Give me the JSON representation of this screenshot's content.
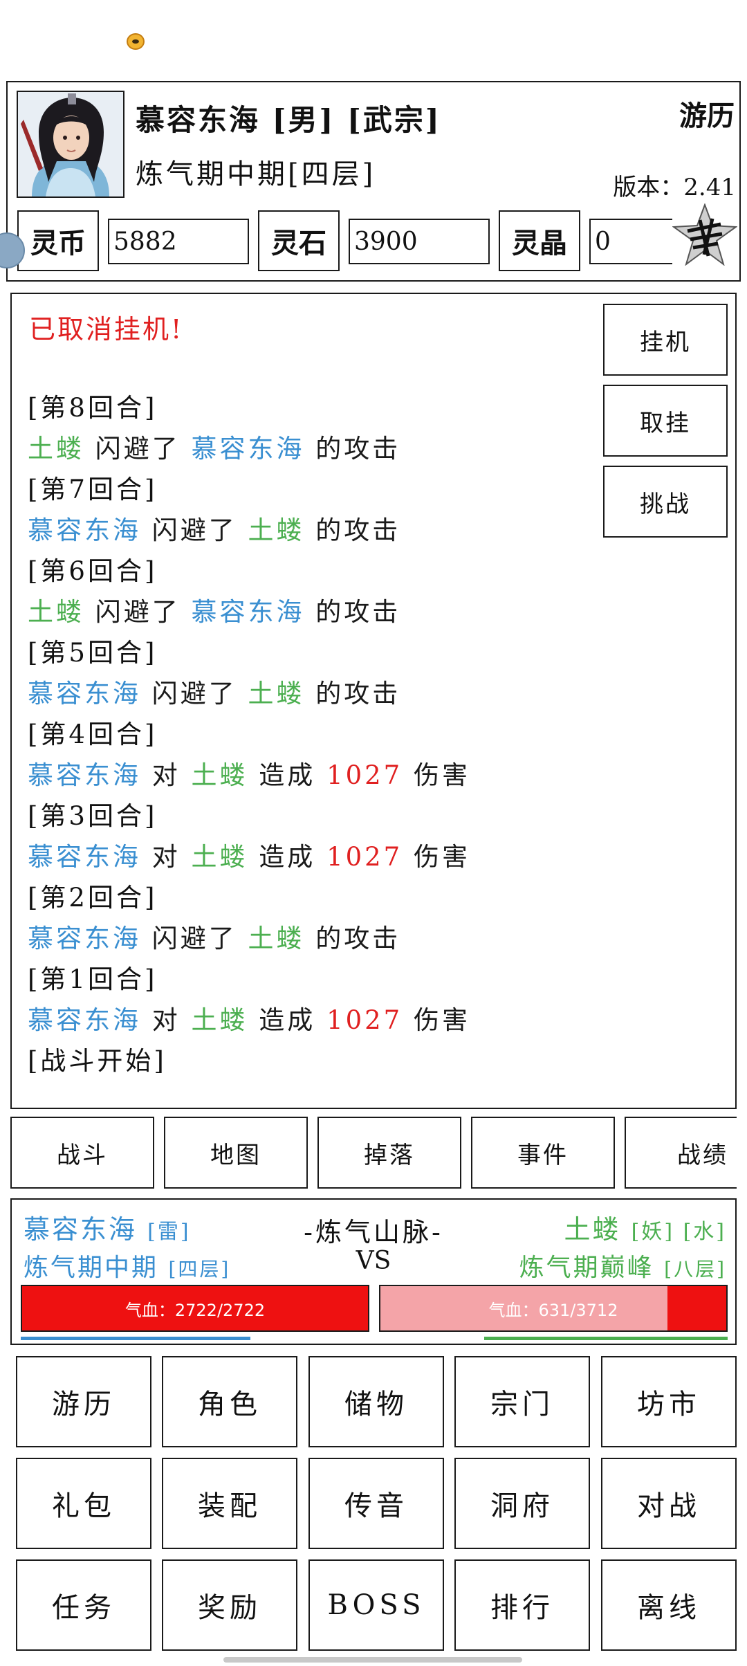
{
  "header": {
    "player_name": "慕容东海 [男] [武宗]",
    "player_realm": "炼气期中期[四层]",
    "location_title": "游历",
    "version_label": "版本：",
    "version_value": "2.41"
  },
  "currencies": [
    {
      "label": "灵币",
      "value": "5882"
    },
    {
      "label": "灵石",
      "value": "3900"
    },
    {
      "label": "灵晶",
      "value": "0"
    }
  ],
  "log": {
    "status_message": "已取消挂机!",
    "lines": [
      {
        "type": "round",
        "text": "[第8回合]"
      },
      {
        "type": "event",
        "parts": [
          {
            "t": "土蝼",
            "c": "green"
          },
          {
            "t": " 闪避了 ",
            "c": "black"
          },
          {
            "t": "慕容东海",
            "c": "blue"
          },
          {
            "t": " 的攻击",
            "c": "black"
          }
        ]
      },
      {
        "type": "round",
        "text": "[第7回合]"
      },
      {
        "type": "event",
        "parts": [
          {
            "t": "慕容东海",
            "c": "blue"
          },
          {
            "t": " 闪避了 ",
            "c": "black"
          },
          {
            "t": "土蝼",
            "c": "green"
          },
          {
            "t": " 的攻击",
            "c": "black"
          }
        ]
      },
      {
        "type": "round",
        "text": "[第6回合]"
      },
      {
        "type": "event",
        "parts": [
          {
            "t": "土蝼",
            "c": "green"
          },
          {
            "t": " 闪避了 ",
            "c": "black"
          },
          {
            "t": "慕容东海",
            "c": "blue"
          },
          {
            "t": " 的攻击",
            "c": "black"
          }
        ]
      },
      {
        "type": "round",
        "text": "[第5回合]"
      },
      {
        "type": "event",
        "parts": [
          {
            "t": "慕容东海",
            "c": "blue"
          },
          {
            "t": " 闪避了 ",
            "c": "black"
          },
          {
            "t": "土蝼",
            "c": "green"
          },
          {
            "t": " 的攻击",
            "c": "black"
          }
        ]
      },
      {
        "type": "round",
        "text": "[第4回合]"
      },
      {
        "type": "event",
        "parts": [
          {
            "t": "慕容东海",
            "c": "blue"
          },
          {
            "t": " 对 ",
            "c": "black"
          },
          {
            "t": "土蝼",
            "c": "green"
          },
          {
            "t": " 造成 ",
            "c": "black"
          },
          {
            "t": "1027",
            "c": "red"
          },
          {
            "t": " 伤害",
            "c": "black"
          }
        ]
      },
      {
        "type": "round",
        "text": "[第3回合]"
      },
      {
        "type": "event",
        "parts": [
          {
            "t": "慕容东海",
            "c": "blue"
          },
          {
            "t": " 对 ",
            "c": "black"
          },
          {
            "t": "土蝼",
            "c": "green"
          },
          {
            "t": " 造成 ",
            "c": "black"
          },
          {
            "t": "1027",
            "c": "red"
          },
          {
            "t": " 伤害",
            "c": "black"
          }
        ]
      },
      {
        "type": "round",
        "text": "[第2回合]"
      },
      {
        "type": "event",
        "parts": [
          {
            "t": "慕容东海",
            "c": "blue"
          },
          {
            "t": " 闪避了 ",
            "c": "black"
          },
          {
            "t": "土蝼",
            "c": "green"
          },
          {
            "t": " 的攻击",
            "c": "black"
          }
        ]
      },
      {
        "type": "round",
        "text": "[第1回合]"
      },
      {
        "type": "event",
        "parts": [
          {
            "t": "慕容东海",
            "c": "blue"
          },
          {
            "t": " 对 ",
            "c": "black"
          },
          {
            "t": "土蝼",
            "c": "green"
          },
          {
            "t": " 造成 ",
            "c": "black"
          },
          {
            "t": "1027",
            "c": "red"
          },
          {
            "t": " 伤害",
            "c": "black"
          }
        ]
      },
      {
        "type": "round",
        "text": "[战斗开始]"
      }
    ]
  },
  "side_buttons": {
    "idle": "挂机",
    "cancel_idle": "取挂",
    "challenge": "挑战"
  },
  "tabs": [
    "战斗",
    "地图",
    "掉落",
    "事件",
    "战绩"
  ],
  "battle": {
    "map_name": "-炼气山脉-",
    "vs": "VS",
    "player": {
      "name": "慕容东海",
      "tag": "[雷]",
      "realm": "炼气期中期",
      "layer": "[四层]",
      "hp_label": "气血：2722/2722",
      "hp_ratio": 1.0
    },
    "enemy": {
      "name": "土蝼",
      "tags": "[妖] [水]",
      "realm": "炼气期巅峰",
      "layer": "[八层]",
      "hp_label": "气血：631/3712",
      "hp_ratio": 0.17
    }
  },
  "menu": [
    "游历",
    "角色",
    "储物",
    "宗门",
    "坊市",
    "礼包",
    "装配",
    "传音",
    "洞府",
    "对战",
    "任务",
    "奖励",
    "BOSS",
    "排行",
    "离线"
  ],
  "colors": {
    "player": "#3a8fd1",
    "enemy": "#4caf50",
    "damage": "#e02020",
    "hp_full": "#ee1111",
    "hp_empty": "#f4a4a8"
  },
  "icons": {
    "avatar": "character-portrait",
    "emblem": "sect-emblem-icon"
  }
}
